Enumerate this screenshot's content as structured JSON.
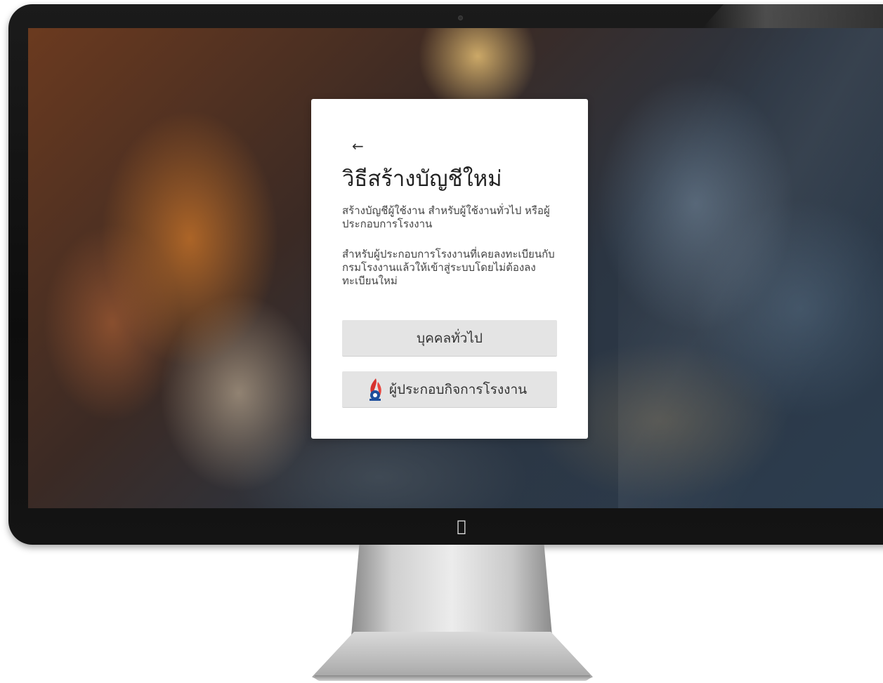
{
  "dialog": {
    "back_icon": "arrow-left-icon",
    "title": "วิธีสร้างบัญชีใหม่",
    "description_1": "สร้างบัญชีผู้ใช้งาน สำหรับผู้ใช้งานทั่วไป หรือผู้ประกอบการโรงงาน",
    "description_2": "สำหรับผู้ประกอบการโรงงานที่เคยลงทะเบียนกับกรมโรงงานแล้วให้เข้าสู่ระบบโดยไม่ต้องลงทะเบียนใหม่",
    "buttons": [
      {
        "label": "บุคคลทั่วไป"
      },
      {
        "label": "ผู้ประกอบกิจการโรงงาน",
        "icon": "factory-department-logo"
      }
    ]
  },
  "device": {
    "brand_icon": "apple-logo-icon"
  },
  "colors": {
    "card_background": "#ffffff",
    "button_background": "#e4e4e4",
    "text_primary": "#222222",
    "bezel": "#111111"
  }
}
